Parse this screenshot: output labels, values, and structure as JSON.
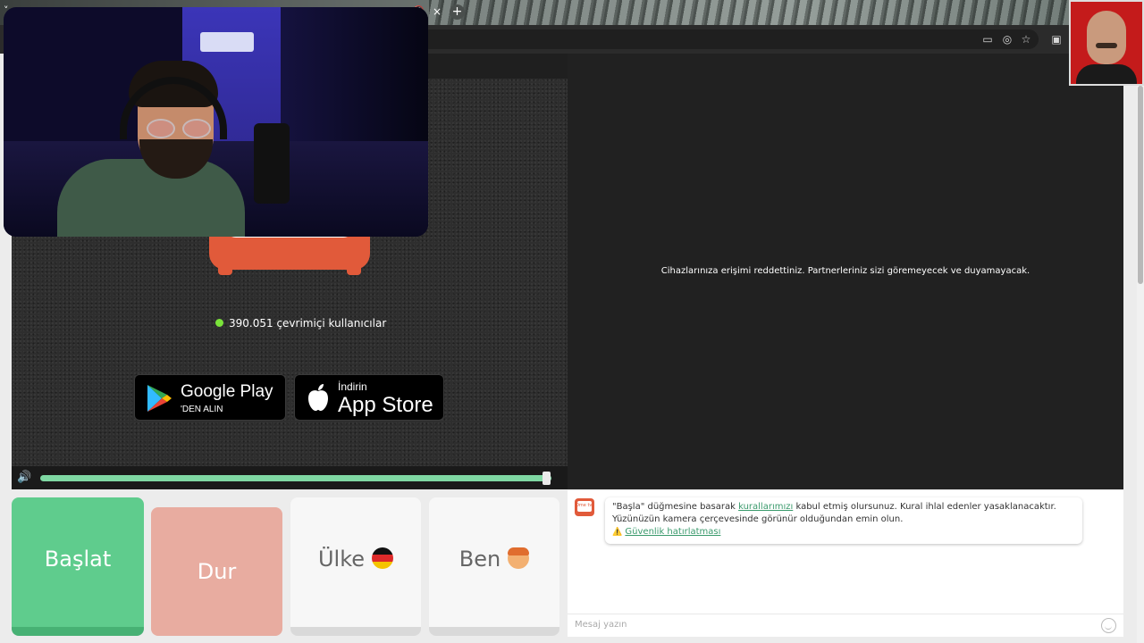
{
  "browser": {
    "tab_chevron": "˅",
    "tab_close": "×",
    "new_tab": "+",
    "toolbar_icons": [
      "cast-icon",
      "eye-off-icon",
      "star-icon",
      "extensions-icon"
    ]
  },
  "left_panel": {
    "online_count": "390.051 çevrimiçi kullanıcılar",
    "google_play": {
      "small": "'DEN ALIN",
      "big": "Google Play"
    },
    "app_store": {
      "small": "İndirin",
      "big": "App Store"
    },
    "volume_level": 0.98,
    "volume_icon": "🔊"
  },
  "right_panel": {
    "denied_message": "Cihazlarınıza erişimi reddettiniz. Partnerleriniz sizi göremeyecek ve duyamayacak."
  },
  "controls": {
    "start_label": "Başlat",
    "stop_label": "Dur",
    "country_label": "Ülke",
    "me_label": "Ben"
  },
  "chat": {
    "logo_text": "Ome tv",
    "msg_part1": "\"Başla\" düğmesine basarak ",
    "msg_rules_link": "kurallarımızı",
    "msg_part2": " kabul etmiş olursunuz. Kural ihlal edenler yasaklanacaktır. Yüzünüzün kamera çerçevesinde görünür olduğundan emin olun.",
    "warning_icon": "⚠️",
    "safety_link": "Güvenlik hatırlatması",
    "input_placeholder": "Mesaj yazın"
  },
  "colors": {
    "start_green": "#5fcc8d",
    "stop_pink": "#e8aca0",
    "brand_orange": "#e15a3a",
    "online_green": "#7ae33a"
  }
}
